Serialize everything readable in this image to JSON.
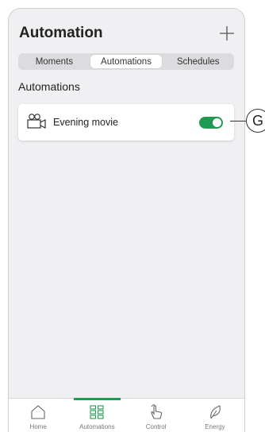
{
  "header": {
    "title": "Automation"
  },
  "segments": [
    {
      "label": "Moments",
      "active": false
    },
    {
      "label": "Automations",
      "active": true
    },
    {
      "label": "Schedules",
      "active": false
    }
  ],
  "section": {
    "title": "Automations"
  },
  "automations": [
    {
      "label": "Evening movie",
      "icon": "movie-camera-icon",
      "enabled": true
    }
  ],
  "callout": {
    "letter": "G"
  },
  "tabbar": {
    "items": [
      {
        "label": "Home",
        "icon": "home-icon",
        "active": false
      },
      {
        "label": "Automations",
        "icon": "grid-icon",
        "active": true
      },
      {
        "label": "Control",
        "icon": "hand-pointer-icon",
        "active": false
      },
      {
        "label": "Energy",
        "icon": "leaf-icon",
        "active": false
      }
    ]
  },
  "colors": {
    "accent": "#1f9a53",
    "background": "#f0f0f2",
    "card": "#ffffff",
    "segment_track": "#dcdcdf"
  }
}
